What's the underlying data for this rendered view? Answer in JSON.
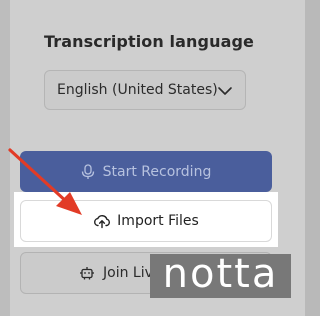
{
  "transcription": {
    "title": "Transcription language",
    "selected_language": "English (United States)"
  },
  "actions": {
    "start_recording_label": "Start Recording",
    "import_files_label": "Import Files",
    "join_live_meeting_label": "Join Live Meeting"
  },
  "watermark": {
    "text": "notta"
  },
  "colors": {
    "primary": "#4a5e9c",
    "arrow": "#e23b26"
  }
}
